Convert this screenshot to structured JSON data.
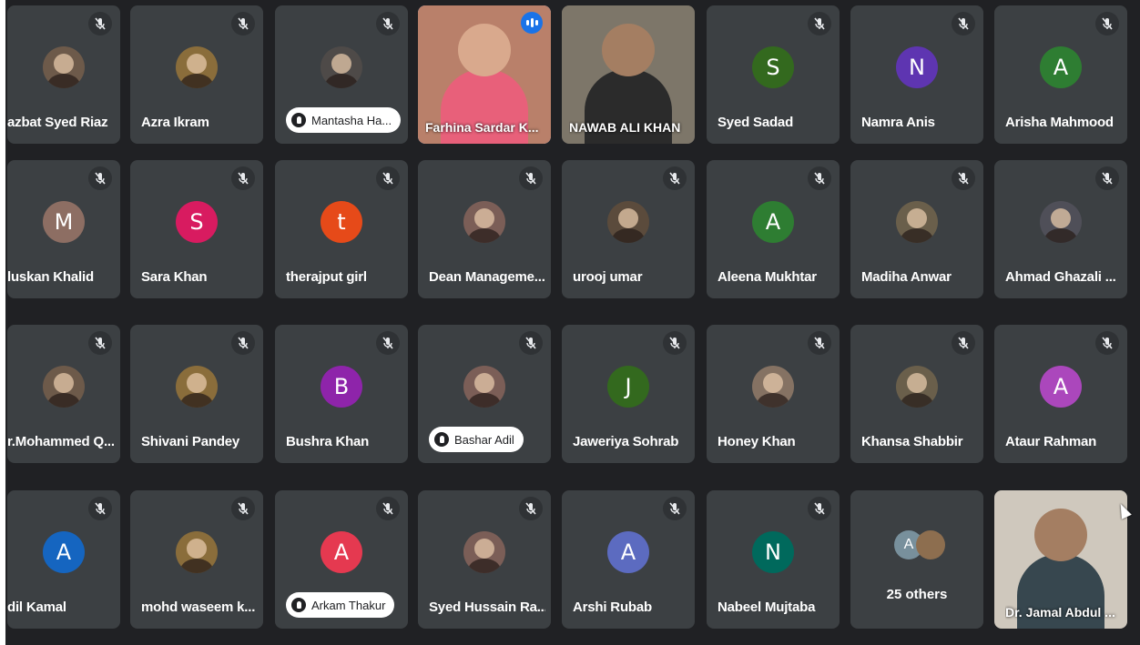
{
  "colors": {
    "background": "#202124",
    "tile": "#3c4043",
    "speaking_outline": "#8ab4f8",
    "speaking_badge": "#1a73e8"
  },
  "tiles": [
    {
      "name": "azbat Syed Riaz",
      "type": "photo"
    },
    {
      "name": "Azra Ikram",
      "type": "photo"
    },
    {
      "name": "Mantasha Ha...",
      "type": "photo",
      "pinned_label": true
    },
    {
      "name": "Farhina Sardar K...",
      "type": "video",
      "speaking": true
    },
    {
      "name": "NAWAB ALI KHAN",
      "type": "video"
    },
    {
      "name": "Syed Sadad",
      "type": "initial",
      "initial": "S",
      "color": "#33691e"
    },
    {
      "name": "Namra Anis",
      "type": "initial",
      "initial": "N",
      "color": "#5e35b1"
    },
    {
      "name": "Arisha Mahmood",
      "type": "initial",
      "initial": "A",
      "color": "#2e7d32"
    },
    {
      "name": "luskan Khalid",
      "type": "initial",
      "initial": "M",
      "color": "#8d6e63"
    },
    {
      "name": "Sara Khan",
      "type": "initial",
      "initial": "S",
      "color": "#d81b60"
    },
    {
      "name": "therajput girl",
      "type": "initial",
      "initial": "t",
      "color": "#e64a19"
    },
    {
      "name": "Dean Manageme...",
      "type": "photo"
    },
    {
      "name": "urooj umar",
      "type": "photo"
    },
    {
      "name": "Aleena Mukhtar",
      "type": "initial",
      "initial": "A",
      "color": "#2e7d32"
    },
    {
      "name": "Madiha Anwar",
      "type": "photo"
    },
    {
      "name": "Ahmad Ghazali ...",
      "type": "photo"
    },
    {
      "name": "r.Mohammed Q...",
      "type": "photo"
    },
    {
      "name": "Shivani Pandey",
      "type": "photo"
    },
    {
      "name": "Bushra Khan",
      "type": "initial",
      "initial": "B",
      "color": "#8e24aa"
    },
    {
      "name": "Bashar Adil",
      "type": "photo",
      "pinned_label": true
    },
    {
      "name": "Jaweriya Sohrab",
      "type": "initial",
      "initial": "J",
      "color": "#33691e"
    },
    {
      "name": "Honey Khan",
      "type": "photo"
    },
    {
      "name": "Khansa Shabbir",
      "type": "photo"
    },
    {
      "name": "Ataur Rahman",
      "type": "initial",
      "initial": "A",
      "color": "#ab47bc"
    },
    {
      "name": "dil Kamal",
      "type": "initial",
      "initial": "A",
      "color": "#1565c0"
    },
    {
      "name": "mohd waseem k...",
      "type": "photo"
    },
    {
      "name": "Arkam Thakur",
      "type": "initial",
      "initial": "A",
      "color": "#e53950",
      "pinned_label": true
    },
    {
      "name": "Syed Hussain Ra...",
      "type": "photo"
    },
    {
      "name": "Arshi Rubab",
      "type": "initial",
      "initial": "A",
      "color": "#5c6bc0"
    },
    {
      "name": "Nabeel Mujtaba",
      "type": "initial",
      "initial": "N",
      "color": "#00695c"
    },
    {
      "name": "25 others",
      "type": "others",
      "initial": "A"
    },
    {
      "name": "Dr. Jamal Abdul ...",
      "type": "video"
    }
  ]
}
